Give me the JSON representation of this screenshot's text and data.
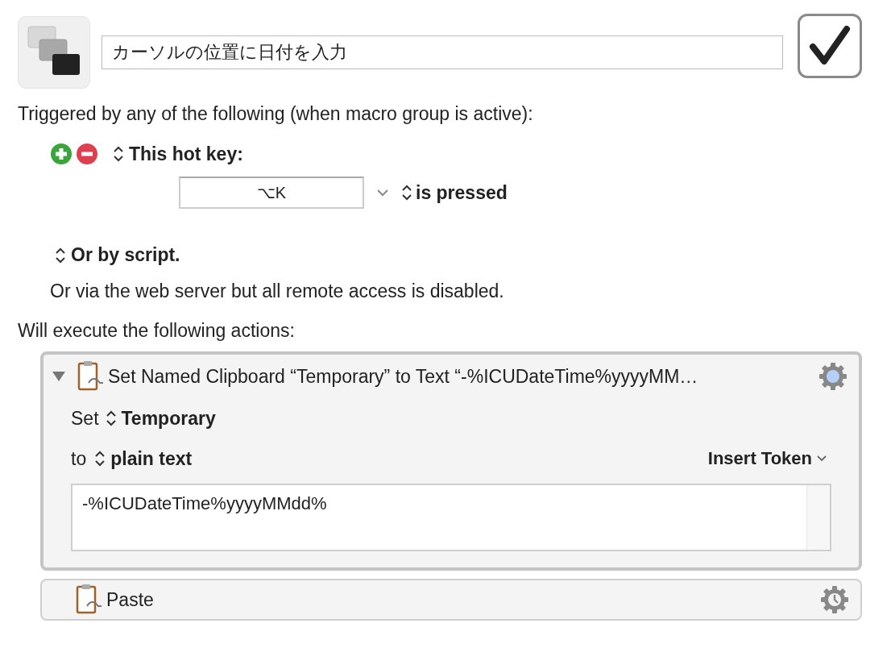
{
  "macro": {
    "name": "カーソルの位置に日付を入力",
    "enabled": true
  },
  "triggers_heading": "Triggered by any of the following (when macro group is active):",
  "hot_key_trigger": {
    "label": "This hot key:",
    "key": "⌥K",
    "condition": "is pressed"
  },
  "script_trigger": "Or by script.",
  "web_server_note": "Or via the web server but all remote access is disabled.",
  "actions_heading": "Will execute the following actions:",
  "actions": [
    {
      "title": "Set Named Clipboard “Temporary” to Text “-%ICUDateTime%yyyyMM…",
      "expanded": true,
      "selected": true,
      "set_label": "Set",
      "clipboard": "Temporary",
      "to_label": "to",
      "format": "plain text",
      "insert_token": "Insert Token",
      "text": "-%ICUDateTime%yyyyMMdd%"
    },
    {
      "title": "Paste",
      "expanded": false,
      "selected": false
    }
  ]
}
